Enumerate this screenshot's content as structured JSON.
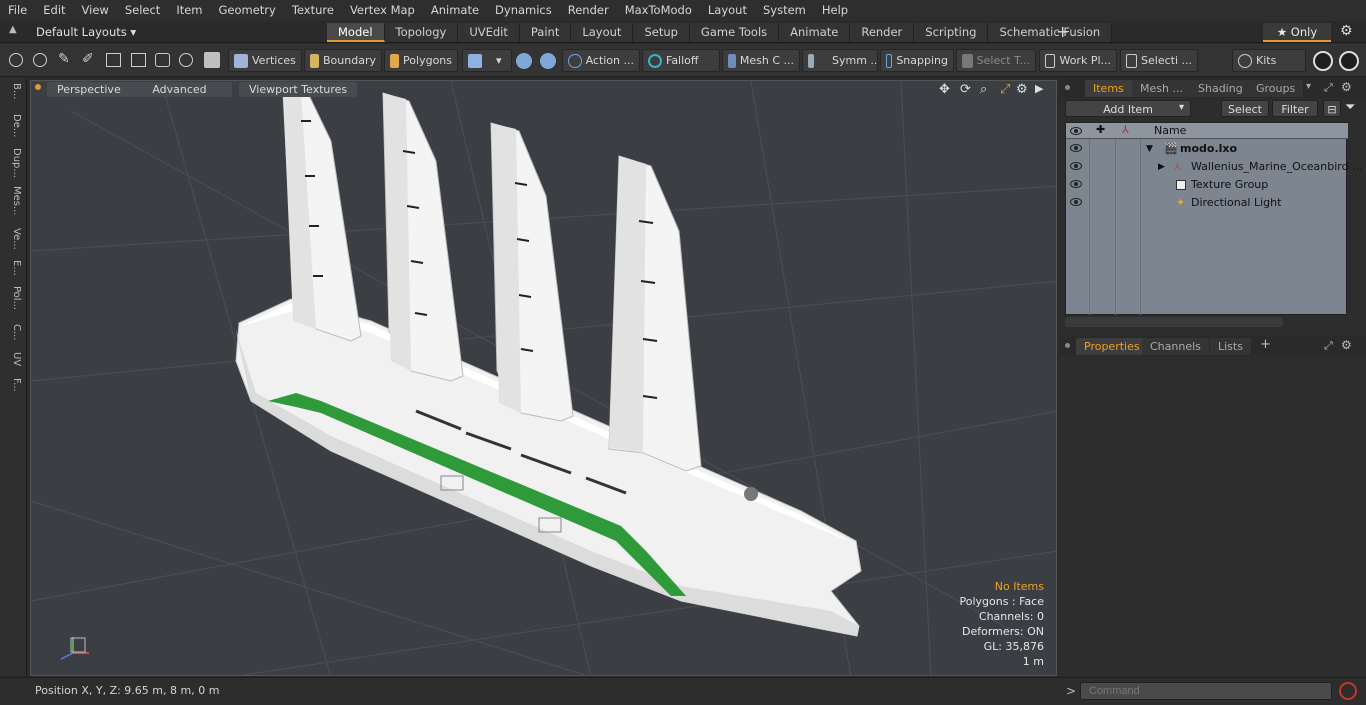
{
  "menubar": {
    "items": [
      "File",
      "Edit",
      "View",
      "Select",
      "Item",
      "Geometry",
      "Texture",
      "Vertex Map",
      "Animate",
      "Dynamics",
      "Render",
      "MaxToModo",
      "Layout",
      "System",
      "Help"
    ]
  },
  "layoutbar": {
    "layout_select": "Default Layouts ▾",
    "tabs": [
      {
        "label": "Model",
        "active": true
      },
      {
        "label": "Topology"
      },
      {
        "label": "UVEdit"
      },
      {
        "label": "Paint"
      },
      {
        "label": "Layout"
      },
      {
        "label": "Setup"
      },
      {
        "label": "Game Tools"
      },
      {
        "label": "Animate"
      },
      {
        "label": "Render"
      },
      {
        "label": "Scripting"
      },
      {
        "label": "Schematic Fusion"
      }
    ],
    "add_tab": "+",
    "only_label": "★ Only"
  },
  "toolbar": {
    "vertices": "Vertices",
    "boundary": "Boundary",
    "polygons": "Polygons",
    "action": "Action ...",
    "falloff": "Falloff",
    "mesh": "Mesh C ...",
    "symm": "Symm ...",
    "snapping": "Snapping",
    "select_t": "Select T...",
    "work_pl": "Work Pl...",
    "selecti": "Selecti ...",
    "kits": "Kits"
  },
  "leftstrip": {
    "labels": [
      "B...",
      "De...",
      "Dup...",
      "Mes...",
      "Ve...",
      "E...",
      "Pol...",
      "C...",
      "UV",
      "F..."
    ]
  },
  "viewport": {
    "perspective": "Perspective",
    "advanced": "Advanced",
    "textures": "Viewport Textures",
    "stats": {
      "no_items": "No Items",
      "polygons": "Polygons : Face",
      "channels": "Channels: 0",
      "deformers": "Deformers: ON",
      "gl": "GL: 35,876",
      "scale": "1 m"
    },
    "colors": {
      "background": "#3b3f44",
      "hull": "#f2f2f2",
      "stripe": "#2e9a3a"
    }
  },
  "items_panel": {
    "tabs": [
      "Items",
      "Mesh ...",
      "Shading",
      "Groups"
    ],
    "add_item": "Add Item",
    "select": "Select",
    "filter": "Filter",
    "name_header": "Name",
    "rows": [
      {
        "label": "modo.lxo",
        "bold": true
      },
      {
        "label": "Wallenius_Marine_Oceanbird ..."
      },
      {
        "label": "Texture Group"
      },
      {
        "label": "Directional Light"
      }
    ]
  },
  "properties_panel": {
    "tabs": [
      "Properties",
      "Channels",
      "Lists",
      "+"
    ]
  },
  "statusbar": {
    "position": "Position X, Y, Z:   9.65 m, 8 m, 0 m",
    "command_placeholder": "Command"
  }
}
